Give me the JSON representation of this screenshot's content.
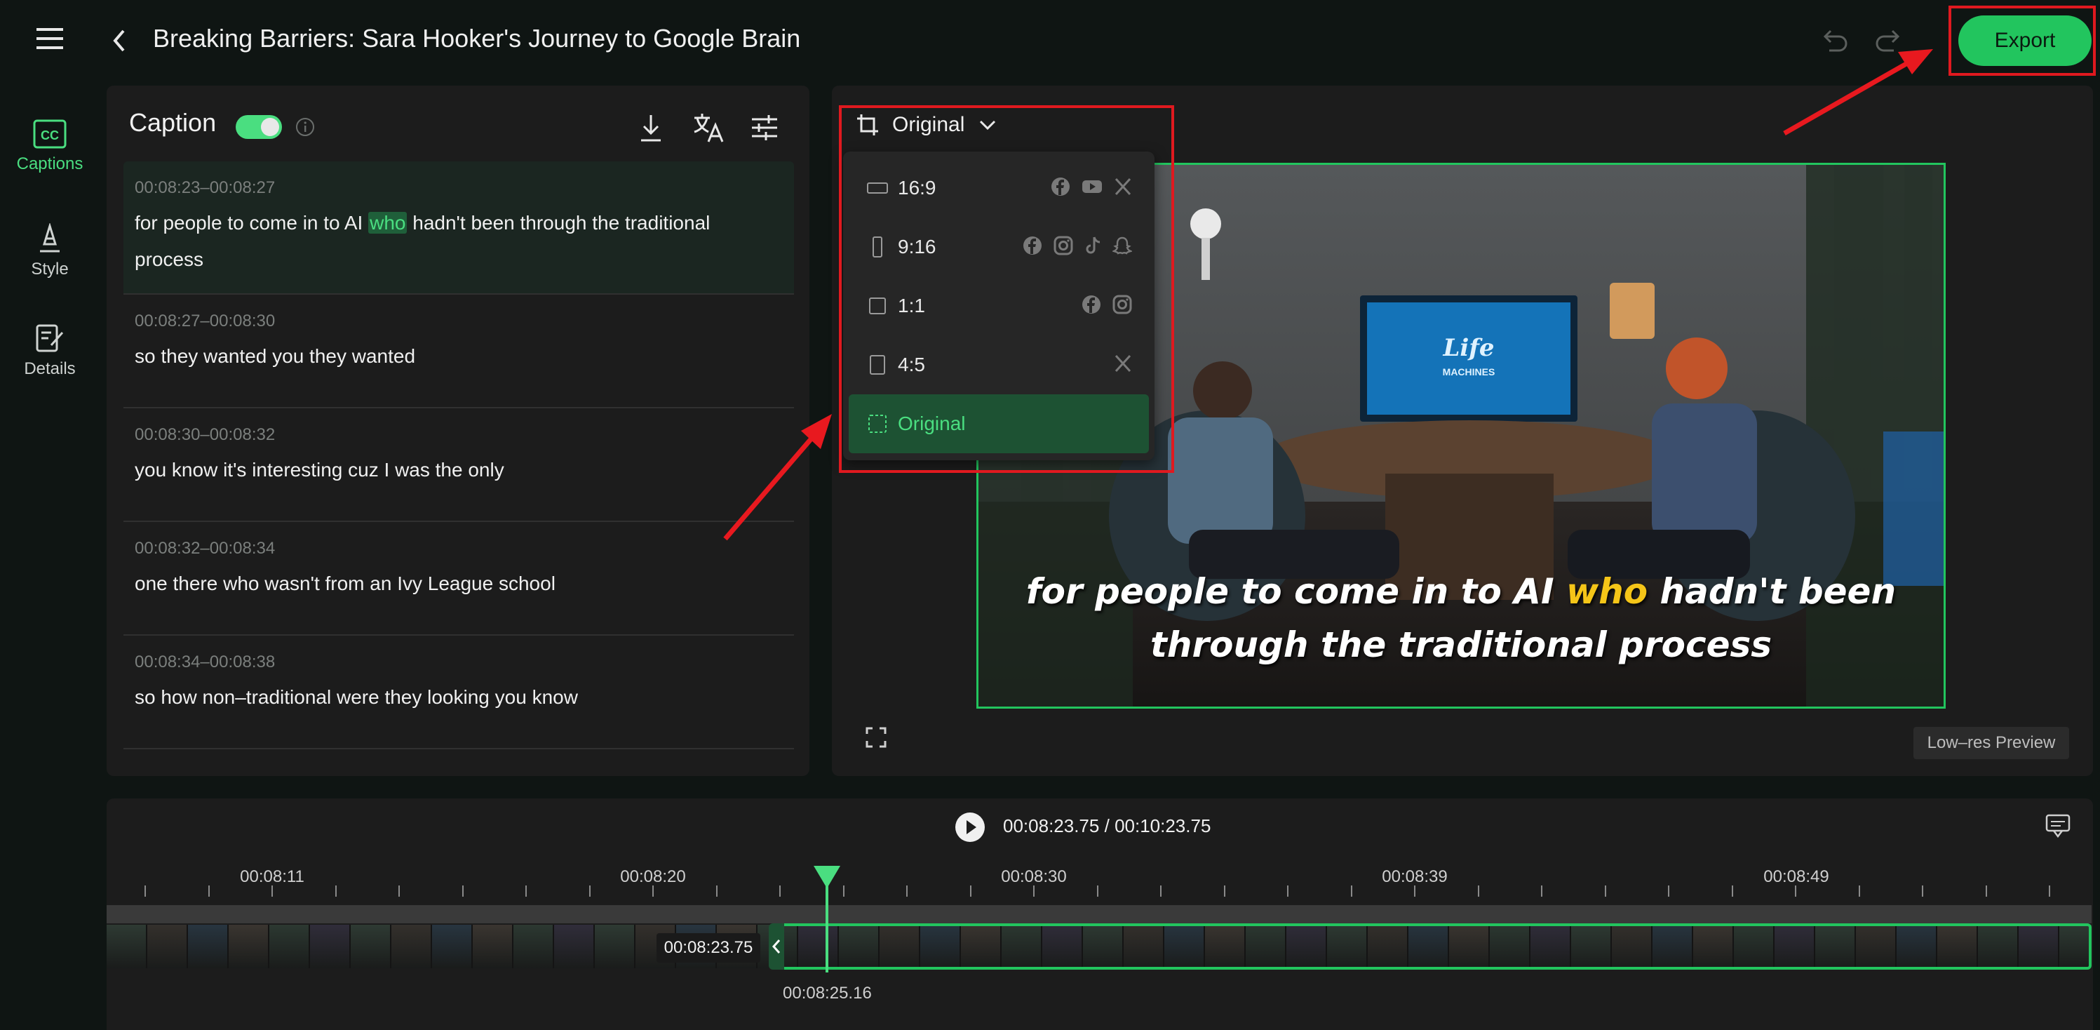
{
  "header": {
    "title": "Breaking Barriers: Sara Hooker's Journey to Google Brain",
    "export_label": "Export",
    "icons": [
      "menu-icon",
      "back-icon",
      "undo-icon",
      "redo-icon"
    ]
  },
  "sidebar": {
    "items": [
      {
        "label": "Captions",
        "icon": "cc-icon",
        "active": true
      },
      {
        "label": "Style",
        "icon": "style-icon",
        "active": false
      },
      {
        "label": "Details",
        "icon": "edit-icon",
        "active": false
      }
    ]
  },
  "caption_panel": {
    "title": "Caption",
    "toggle_on": true,
    "tools": [
      "download-icon",
      "translate-icon",
      "settings-sliders-icon"
    ],
    "items": [
      {
        "time": "00:08:23–00:08:27",
        "before": "for people to come in to AI ",
        "highlight": "who",
        "after": " hadn't been through the traditional process"
      },
      {
        "time": "00:08:27–00:08:30",
        "text": "so they wanted you they wanted"
      },
      {
        "time": "00:08:30–00:08:32",
        "text": "you know it's interesting cuz I was the only"
      },
      {
        "time": "00:08:32–00:08:34",
        "text": "one there who wasn't from an Ivy League school"
      },
      {
        "time": "00:08:34–00:08:38",
        "text": "so how non–traditional were they looking you know"
      }
    ]
  },
  "preview": {
    "ratio_selected": "Original",
    "ratio_options": [
      {
        "label": "16:9",
        "socials": [
          "facebook-icon",
          "youtube-icon",
          "x-icon"
        ]
      },
      {
        "label": "9:16",
        "socials": [
          "facebook-icon",
          "instagram-icon",
          "tiktok-icon",
          "snapchat-icon"
        ]
      },
      {
        "label": "1:1",
        "socials": [
          "facebook-icon",
          "instagram-icon"
        ]
      },
      {
        "label": "4:5",
        "socials": [
          "x-icon"
        ]
      },
      {
        "label": "Original",
        "socials": [],
        "selected": true
      }
    ],
    "video_caption_before": "for people to come in to AI ",
    "video_caption_highlight": "who",
    "video_caption_after": " hadn't been through the traditional process",
    "tv_logo_line1": "Life",
    "tv_logo_line2": "MACHINES",
    "lowres_label": "Low–res Preview"
  },
  "timeline": {
    "current_time": "00:08:23.75",
    "separator": "/",
    "total_time": "00:10:23.75",
    "ruler_labels": [
      "00:08:11",
      "00:08:20",
      "00:08:30",
      "00:08:39",
      "00:08:49"
    ],
    "clip_start_label": "00:08:23.75",
    "clip_end_label": "00:08:25.16"
  },
  "colors": {
    "accent": "#22c55e",
    "accent_light": "#4ade80",
    "highlight_red": "#e0191f",
    "caption_yellow": "#f5c518",
    "panel": "#1c1c1c",
    "background": "#0f1513"
  }
}
